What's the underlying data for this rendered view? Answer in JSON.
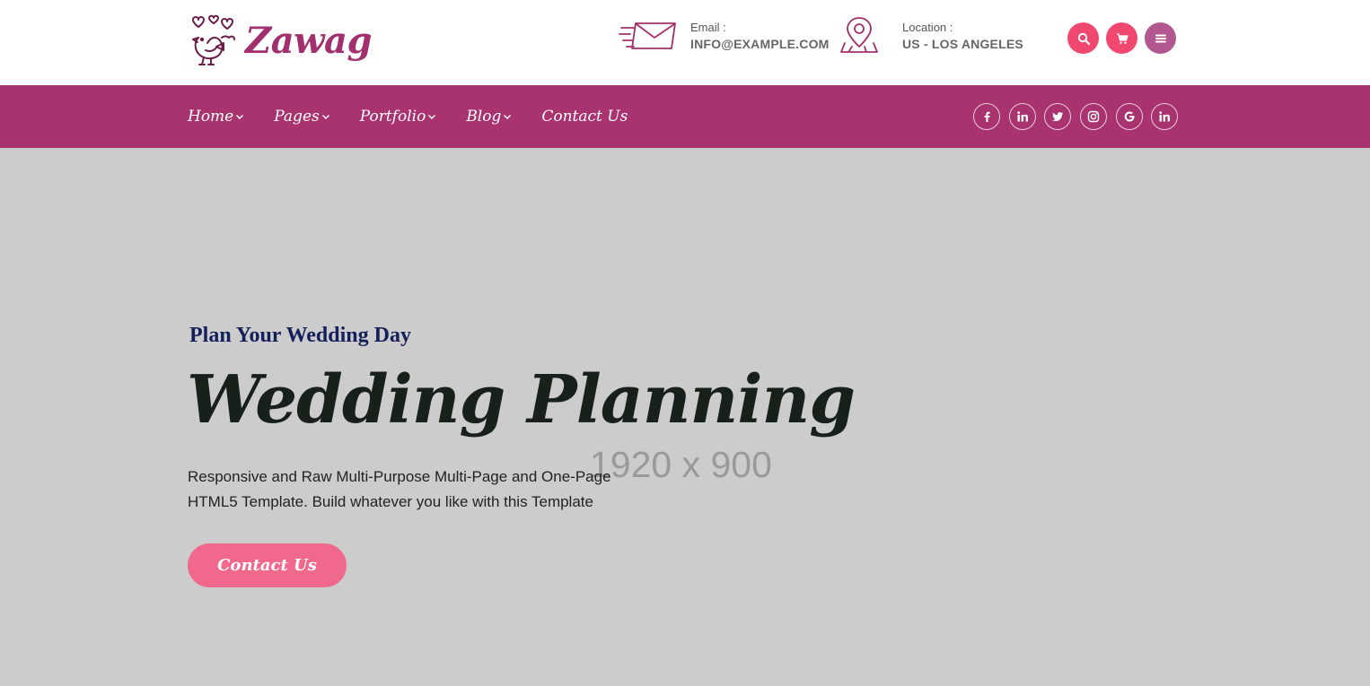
{
  "brand": {
    "name": "Zawag"
  },
  "contact": {
    "email_label": "Email :",
    "email_value": "INFO@EXAMPLE.COM",
    "location_label": "Location :",
    "location_value": "US - LOS ANGELES"
  },
  "header_actions": [
    {
      "icon": "search-icon",
      "color": "#f0486f"
    },
    {
      "icon": "cart-icon",
      "color": "#f0486f"
    },
    {
      "icon": "hamburger-menu-icon",
      "color": "#b2578f"
    }
  ],
  "nav": {
    "items": [
      {
        "label": "Home",
        "has_dropdown": true
      },
      {
        "label": "Pages",
        "has_dropdown": true
      },
      {
        "label": "Portfolio",
        "has_dropdown": true
      },
      {
        "label": "Blog",
        "has_dropdown": true
      },
      {
        "label": "Contact Us",
        "has_dropdown": false
      }
    ]
  },
  "socials": [
    "facebook-icon",
    "linkedin-icon",
    "twitter-icon",
    "instagram-icon",
    "google-icon",
    "linkedin-icon"
  ],
  "hero": {
    "placeholder": "1920 x 900",
    "eyebrow": "Plan Your Wedding Day",
    "title": "Wedding Planning",
    "description_line1": "Responsive and Raw Multi-Purpose Multi-Page and One-Page",
    "description_line2": "HTML5 Template. Build whatever you like with this Template",
    "cta_label": "Contact Us"
  },
  "colors": {
    "brand": "#a3306e",
    "navbar": "#a9336f",
    "accent": "#f0486f",
    "cta": "#f0688c",
    "hero_bg": "#cccccc"
  }
}
